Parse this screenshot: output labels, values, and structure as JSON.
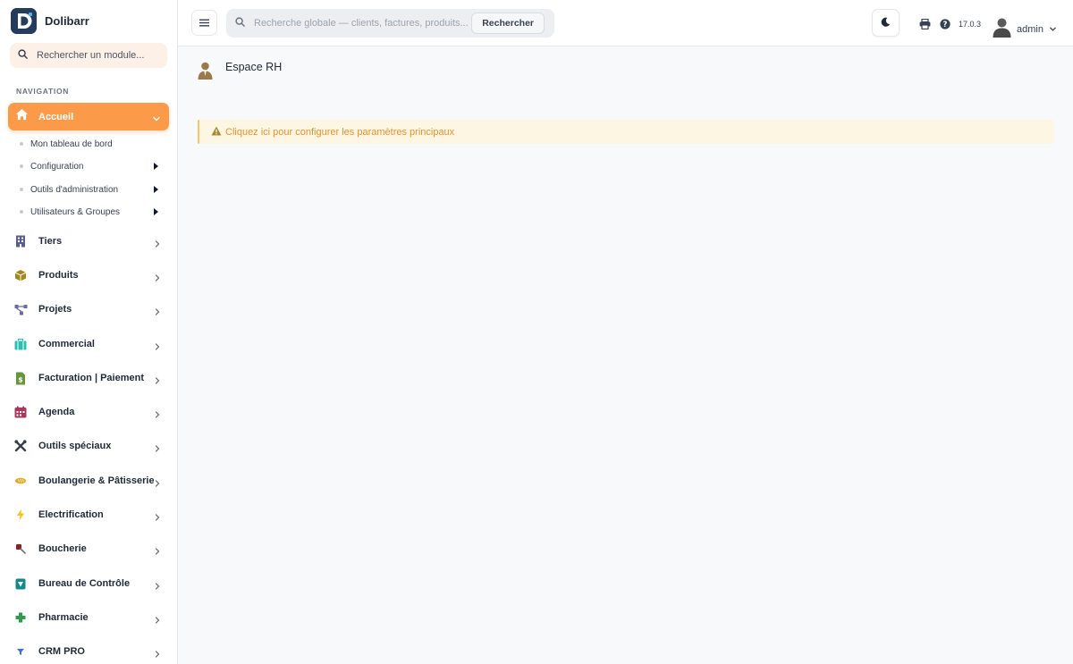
{
  "brand": {
    "name": "Dolibarr",
    "logo_letter": "D"
  },
  "module_search": {
    "placeholder": "Rechercher un module..."
  },
  "nav": {
    "heading": "NAVIGATION",
    "active": {
      "label": "Accueil",
      "icon": "home-icon"
    },
    "subitems": [
      {
        "label": "Mon tableau de bord",
        "has_submenu": false
      },
      {
        "label": "Configuration",
        "has_submenu": true
      },
      {
        "label": "Outils d'administration",
        "has_submenu": true
      },
      {
        "label": "Utilisateurs & Groupes",
        "has_submenu": true
      }
    ],
    "items": [
      {
        "label": "Tiers",
        "icon": "building-icon",
        "color": "#5a5e8c"
      },
      {
        "label": "Produits",
        "icon": "box-icon",
        "color": "#a08a1e"
      },
      {
        "label": "Projets",
        "icon": "sitemap-icon",
        "color": "#6a6aa8"
      },
      {
        "label": "Commercial",
        "icon": "briefcase-icon",
        "color": "#2bbfb3"
      },
      {
        "label": "Facturation | Paiement",
        "icon": "invoice-icon",
        "color": "#65953d"
      },
      {
        "label": "Agenda",
        "icon": "calendar-icon",
        "color": "#a8385a"
      },
      {
        "label": "Outils spéciaux",
        "icon": "tools-icon",
        "color": "#3a3f47"
      },
      {
        "label": "Boulangerie & Pâtisserie",
        "icon": "bread-icon",
        "color": "#e0a820"
      },
      {
        "label": "Electrification",
        "icon": "bolt-icon",
        "color": "#f2c21b"
      },
      {
        "label": "Boucherie",
        "icon": "meat-icon",
        "color": "#8b1e1e"
      },
      {
        "label": "Bureau de Contrôle",
        "icon": "shield-icon",
        "color": "#138a8a"
      },
      {
        "label": "Pharmacie",
        "icon": "plus-cross-icon",
        "color": "#2e9d4a"
      },
      {
        "label": "CRM PRO",
        "icon": "funnel-icon",
        "color": "#3d6fd6"
      }
    ]
  },
  "topbar": {
    "search_placeholder": "Recherche globale — clients, factures, produits...",
    "search_button": "Rechercher",
    "version": "17.0.3",
    "user_name": "admin"
  },
  "main": {
    "title": "Espace RH",
    "alert_text": "Cliquez ici pour configurer les paramètres principaux"
  },
  "colors": {
    "accent": "#fb9b4a",
    "alert_bg": "#fdf6e3",
    "alert_text": "#e8902b",
    "brand_logo": "#263c5c"
  }
}
